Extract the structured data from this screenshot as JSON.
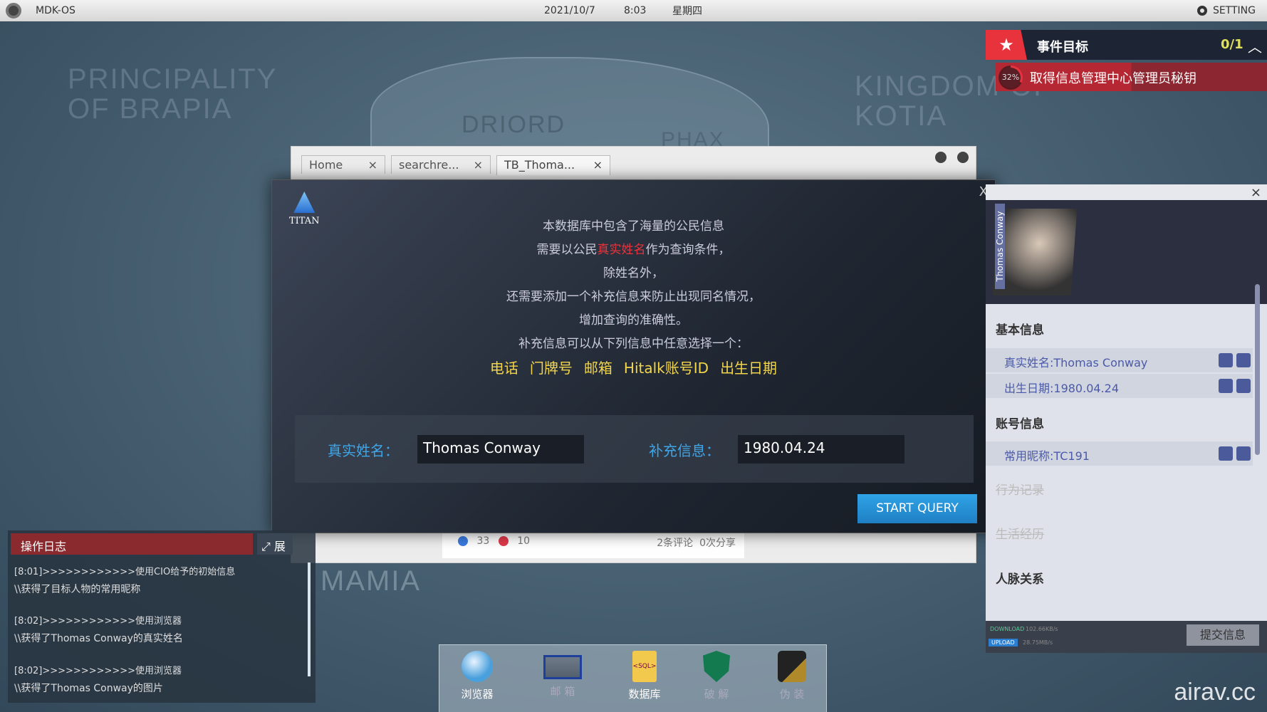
{
  "topbar": {
    "os": "MDK-OS",
    "date": "2021/10/7",
    "time": "8:03",
    "weekday": "星期四",
    "setting": "SETTING"
  },
  "map": {
    "labels": [
      "PRINCIPALITY\nOF BRAPIA",
      "DRIORD",
      "PHAX",
      "KINGDOM OF\nKOTIA",
      "MAMIA"
    ]
  },
  "event": {
    "title": "事件目标",
    "count": "0/1",
    "progress_percent": 32,
    "progress_label": "32%",
    "task": "取得信息管理中心管理员秘钥",
    "accent": "#e8323c"
  },
  "browser": {
    "tabs": [
      {
        "label": "Home"
      },
      {
        "label": "searchre..."
      },
      {
        "label": "TB_Thoma..."
      }
    ],
    "close_glyph": "×",
    "likes": "33",
    "hearts": "10",
    "comments": "2条评论",
    "shares": "0次分享"
  },
  "dialog": {
    "logo": "TITAN",
    "lines": [
      "本数据库中包含了海量的公民信息",
      "作为查询条件，",
      "除姓名外，",
      "还需要添加一个补充信息来防止出现同名情况，",
      "增加查询的准确性。",
      "补充信息可以从下列信息中任意选择一个："
    ],
    "line2_prefix": "需要以公民",
    "line2_highlight": "真实姓名",
    "options": [
      "电话",
      "门牌号",
      "邮箱",
      "Hitalk账号ID",
      "出生日期"
    ],
    "name_label": "真实姓名：",
    "name_value": "Thomas Conway",
    "extra_label": "补充信息：",
    "extra_value": "1980.04.24",
    "button": "START QUERY",
    "close": "X"
  },
  "profile": {
    "photo_name": "Thomas Conway",
    "sections": {
      "basic": "基本信息",
      "account": "账号信息",
      "behavior": "行为记录",
      "life": "生活经历",
      "relations": "人脉关系"
    },
    "basic_items": [
      "真实姓名:Thomas Conway",
      "出生日期:1980.04.24"
    ],
    "account_items": [
      "常用昵称:TC191"
    ],
    "download_label": "DOWNLOAD",
    "download_speed": "102.66KB/s",
    "upload_label": "UPLOAD",
    "upload_speed": "28.75MB/s",
    "submit": "提交信息"
  },
  "log": {
    "title": "操作日志",
    "expand": "展",
    "entries": [
      {
        "head": "[8:01]>>>>>>>>>>>>使用CIO给予的初始信息",
        "body": "\\\\获得了目标人物的常用昵称"
      },
      {
        "head": "[8:02]>>>>>>>>>>>>使用浏览器",
        "body": "\\\\获得了Thomas Conway的真实姓名"
      },
      {
        "head": "[8:02]>>>>>>>>>>>>使用浏览器",
        "body": "\\\\获得了Thomas Conway的图片"
      }
    ]
  },
  "dock": {
    "apps": [
      {
        "label": "浏览器"
      },
      {
        "label": "邮 箱"
      },
      {
        "label": "数据库"
      },
      {
        "label": "破 解"
      },
      {
        "label": "伪 装"
      }
    ]
  },
  "watermark": "airav.cc"
}
